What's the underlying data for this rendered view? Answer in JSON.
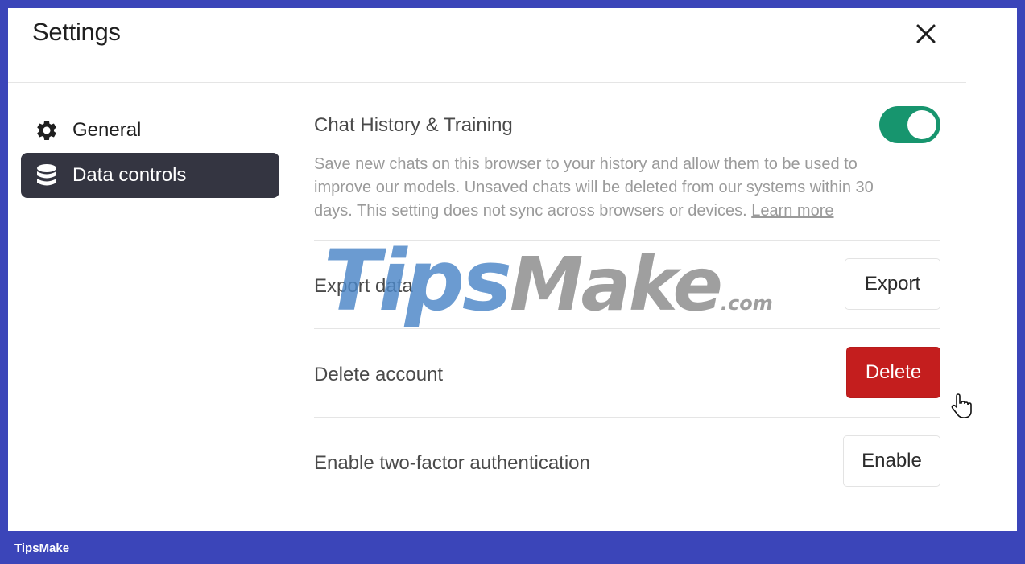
{
  "settings": {
    "title": "Settings",
    "close_icon": "close-icon"
  },
  "sidebar": {
    "items": [
      {
        "label": "General",
        "icon": "gear-icon",
        "active": false
      },
      {
        "label": "Data controls",
        "icon": "database-icon",
        "active": true
      }
    ]
  },
  "chat_history": {
    "title": "Chat History & Training",
    "enabled": true,
    "description": "Save new chats on this browser to your history and allow them to be used to improve our models. Unsaved chats will be deleted from our systems within 30 days. This setting does not sync across browsers or devices.",
    "learn_more": "Learn more"
  },
  "export_data": {
    "title": "Export data",
    "button": "Export"
  },
  "delete_account": {
    "title": "Delete account",
    "button": "Delete"
  },
  "two_factor": {
    "title": "Enable two-factor authentication",
    "button": "Enable"
  },
  "watermark": {
    "main_a": "Tips",
    "main_b": "Make",
    "suffix": ".com"
  },
  "footer": {
    "brand": "TipsMake"
  },
  "colors": {
    "accent_green": "#17956e",
    "danger_red": "#c41e1e",
    "active_sidebar": "#343541",
    "border_blue": "#3b45b9"
  }
}
